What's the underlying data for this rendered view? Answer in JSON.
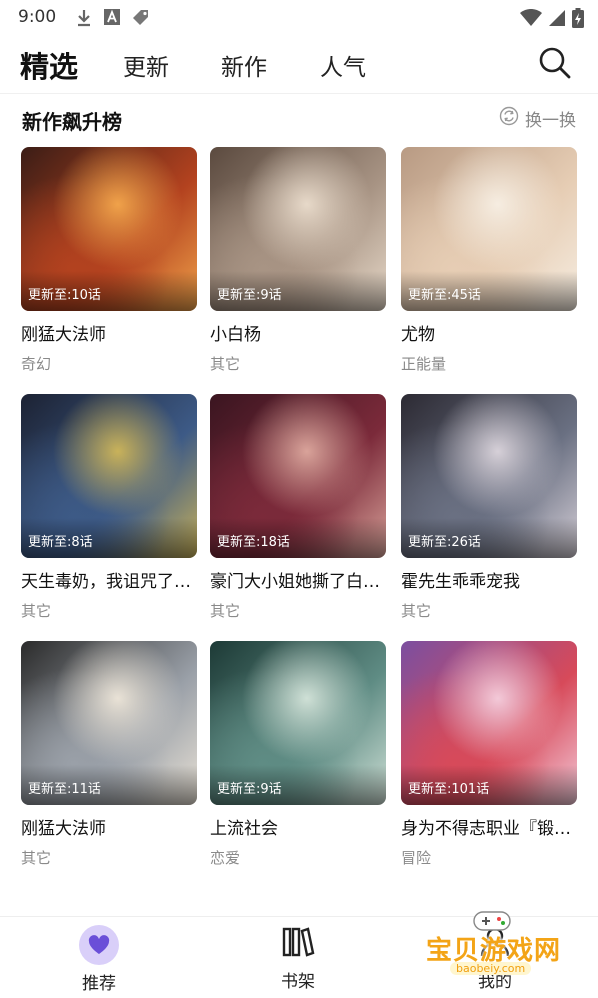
{
  "status_bar": {
    "time": "9:00",
    "icons": [
      "download-icon",
      "a-box-icon",
      "tag-icon",
      "wifi-icon",
      "signal-icon",
      "battery-charging-icon"
    ]
  },
  "top_nav": {
    "tabs": [
      {
        "label": "精选",
        "active": true
      },
      {
        "label": "更新",
        "active": false
      },
      {
        "label": "新作",
        "active": false
      },
      {
        "label": "人气",
        "active": false
      }
    ],
    "search_icon": "search-icon"
  },
  "section": {
    "title": "新作飙升榜",
    "refresh_label": "换一换",
    "refresh_icon": "refresh-icon"
  },
  "comics": [
    {
      "title": "刚猛大法师",
      "genre": "奇幻",
      "episode": "更新至:10话",
      "palette": [
        "#3b1d16",
        "#b3421f",
        "#f0a24a"
      ]
    },
    {
      "title": "小白杨",
      "genre": "其它",
      "episode": "更新至:9话",
      "palette": [
        "#5b4a3f",
        "#a89484",
        "#e7d9c9"
      ]
    },
    {
      "title": "尤物",
      "genre": "正能量",
      "episode": "更新至:45话",
      "palette": [
        "#b89a83",
        "#e6cdb4",
        "#f6ede1"
      ]
    },
    {
      "title": "天生毒奶，我诅咒了全世界！",
      "genre": "其它",
      "episode": "更新至:8话",
      "palette": [
        "#1c2233",
        "#3d5a86",
        "#c9b25a"
      ]
    },
    {
      "title": "豪门大小姐她撕了白月光剧本",
      "genre": "其它",
      "episode": "更新至:18话",
      "palette": [
        "#3a1520",
        "#7b2a3a",
        "#d9a39a"
      ]
    },
    {
      "title": "霍先生乖乖宠我",
      "genre": "其它",
      "episode": "更新至:26话",
      "palette": [
        "#2c2a33",
        "#6a7082",
        "#d6d0d8"
      ]
    },
    {
      "title": "刚猛大法师",
      "genre": "其它",
      "episode": "更新至:11话",
      "palette": [
        "#2b2b2b",
        "#9aa0a8",
        "#e9e2d6"
      ]
    },
    {
      "title": "上流社会",
      "genre": "恋爱",
      "episode": "更新至:9话",
      "palette": [
        "#1d3a36",
        "#5f8c84",
        "#cfe0d6"
      ]
    },
    {
      "title": "身为不得志职业『锻造师』却是最强的",
      "genre": "冒险",
      "episode": "更新至:101话",
      "palette": [
        "#7b4fa0",
        "#d74a5a",
        "#f3c9d8"
      ]
    }
  ],
  "bottom_nav": [
    {
      "label": "推荐",
      "icon": "heart-icon",
      "active": true
    },
    {
      "label": "书架",
      "icon": "bookshelf-icon",
      "active": false
    },
    {
      "label": "我的",
      "icon": "user-icon",
      "active": false
    }
  ],
  "colors": {
    "accent": "#d9cff9",
    "accent_icon": "#6a4fd8",
    "watermark": "#f3a417"
  },
  "watermark": {
    "text": "宝贝游戏网",
    "sub": "baobeiy.com"
  }
}
